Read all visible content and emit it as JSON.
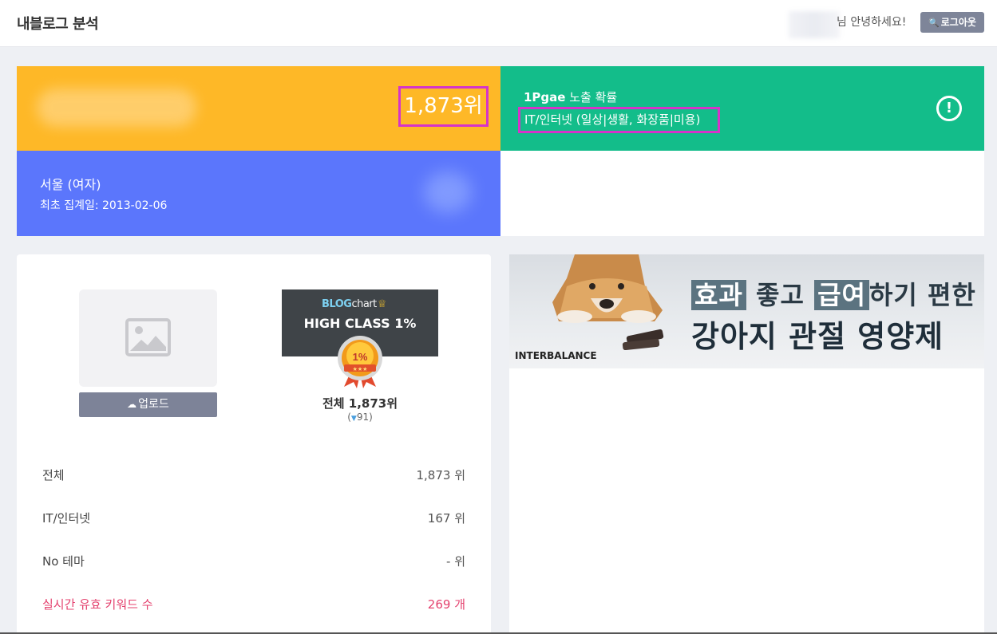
{
  "header": {
    "title": "내블로그 분석",
    "greeting": "님 안녕하세요!",
    "logout_label": "로그아웃",
    "key_icon": "key-icon"
  },
  "summary": {
    "rank": "1,873위",
    "exposure_title_bold": "1Pgae",
    "exposure_title_rest": " 노출 확률",
    "category": "IT/인터넷 (일상|생활, 화장품|미용)",
    "region": "서울 (여자)",
    "first_date": "최초 집계일: 2013-02-06"
  },
  "profile": {
    "upload_label": "업로드",
    "badge_brand_blog": "BLOG",
    "badge_brand_chart": "chart",
    "badge_class": "HIGH CLASS 1%",
    "medal_text": "1%",
    "total_rank": "전체 1,873위",
    "rank_change_arrow": "▼",
    "rank_change_value": "91"
  },
  "stats": [
    {
      "label": "전체",
      "value": "1,873 위"
    },
    {
      "label": "IT/인터넷",
      "value": "167 위"
    },
    {
      "label": "No 테마",
      "value": "- 위"
    },
    {
      "label": "실시간 유효 키워드 수",
      "value": "269 개"
    }
  ],
  "ad": {
    "line1_a": "효과",
    "line1_b": " 좋고 ",
    "line1_c": "급여",
    "line1_d": "하기 편한",
    "line2": "강아지 관절 영양제",
    "brand": "INTERBALANCE"
  },
  "colors": {
    "orange": "#feb827",
    "green": "#13bd8a",
    "blue": "#5b76fc",
    "highlight": "#d633c9",
    "keyword_red": "#e4416e"
  }
}
